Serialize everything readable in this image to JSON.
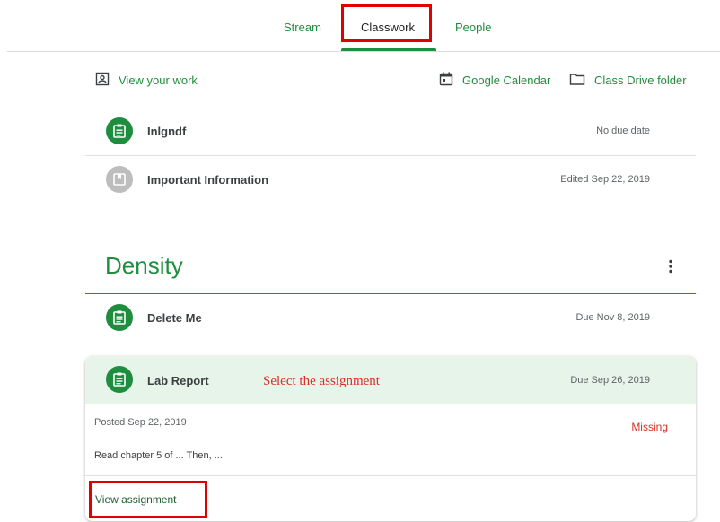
{
  "tabs": [
    {
      "label": "Stream"
    },
    {
      "label": "Classwork"
    },
    {
      "label": "People"
    }
  ],
  "toolbar": {
    "view_work": "View your work",
    "calendar": "Google Calendar",
    "drive": "Class Drive folder"
  },
  "items": [
    {
      "title": "Inlgndf",
      "meta": "No due date",
      "icon": "assignment-icon"
    },
    {
      "title": "Important Information",
      "meta": "Edited Sep 22, 2019",
      "icon": "material-icon"
    }
  ],
  "topic": {
    "title": "Density",
    "items": [
      {
        "title": "Delete Me",
        "meta": "Due Nov 8, 2019",
        "icon": "assignment-icon"
      }
    ]
  },
  "expanded": {
    "title": "Lab Report",
    "meta": "Due Sep 26, 2019",
    "annotation": "Select the assignment",
    "posted": "Posted Sep 22, 2019",
    "status": "Missing",
    "description": "Read chapter 5 of ... Then, ...",
    "action": "View assignment"
  },
  "colors": {
    "accent": "#1e8e3e",
    "highlight": "#e00000",
    "missing": "#d93025"
  }
}
